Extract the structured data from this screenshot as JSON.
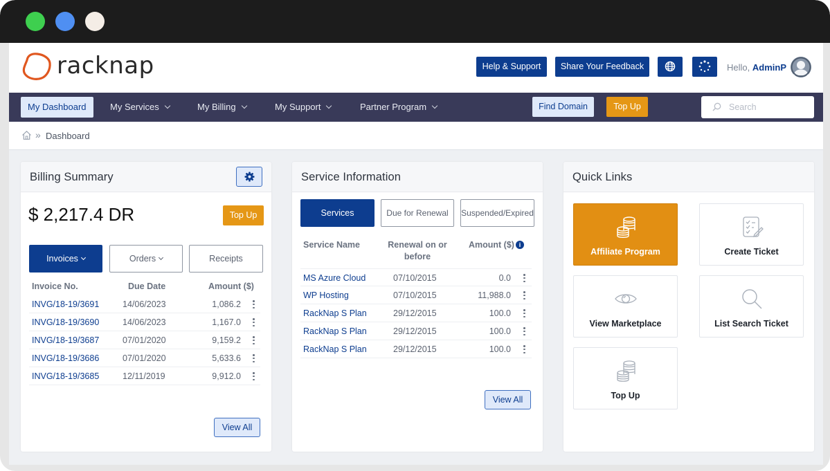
{
  "header": {
    "logo_text": "racknap",
    "help_label": "Help & Support",
    "feedback_label": "Share Your Feedback",
    "greeting": "Hello,",
    "user": "AdminP"
  },
  "nav": {
    "items": [
      {
        "label": "My Dashboard"
      },
      {
        "label": "My Services"
      },
      {
        "label": "My Billing"
      },
      {
        "label": "My Support"
      },
      {
        "label": "Partner Program"
      }
    ],
    "find_domain": "Find Domain",
    "top_up": "Top Up",
    "search_placeholder": "Search"
  },
  "breadcrumb": {
    "sep": "»",
    "current": "Dashboard"
  },
  "billing": {
    "title": "Billing Summary",
    "balance": "$ 2,217.4 DR",
    "top_up": "Top Up",
    "tabs": [
      "Invoices",
      "Orders",
      "Receipts"
    ],
    "headers": [
      "Invoice No.",
      "Due Date",
      "Amount ($)"
    ],
    "rows": [
      {
        "no": "INVG/18-19/3691",
        "date": "14/06/2023",
        "amount": "1,086.2"
      },
      {
        "no": "INVG/18-19/3690",
        "date": "14/06/2023",
        "amount": "1,167.0"
      },
      {
        "no": "INVG/18-19/3687",
        "date": "07/01/2020",
        "amount": "9,159.2"
      },
      {
        "no": "INVG/18-19/3686",
        "date": "07/01/2020",
        "amount": "5,633.6"
      },
      {
        "no": "INVG/18-19/3685",
        "date": "12/11/2019",
        "amount": "9,912.0"
      }
    ],
    "view_all": "View All"
  },
  "service": {
    "title": "Service Information",
    "tabs": [
      "Services",
      "Due for Renewal",
      "Suspended/Expired"
    ],
    "headers": [
      "Service Name",
      "Renewal on or",
      "before",
      "Amount ($)"
    ],
    "info_glyph": "i",
    "rows": [
      {
        "name": "MS Azure Cloud",
        "date": "07/10/2015",
        "amount": "0.0"
      },
      {
        "name": "WP Hosting",
        "date": "07/10/2015",
        "amount": "11,988.0"
      },
      {
        "name": "RackNap S Plan",
        "date": "29/12/2015",
        "amount": "100.0"
      },
      {
        "name": "RackNap S Plan",
        "date": "29/12/2015",
        "amount": "100.0"
      },
      {
        "name": "RackNap S Plan",
        "date": "29/12/2015",
        "amount": "100.0"
      }
    ],
    "view_all": "View All"
  },
  "quick": {
    "title": "Quick Links",
    "links": [
      {
        "label": "Affiliate Program",
        "icon": "coins-icon"
      },
      {
        "label": "Create Ticket",
        "icon": "checklist-icon"
      },
      {
        "label": "View Marketplace",
        "icon": "eye-icon"
      },
      {
        "label": "List Search Ticket",
        "icon": "magnifier-icon"
      },
      {
        "label": "Top Up",
        "icon": "coins-icon"
      }
    ]
  },
  "colors": {
    "primary": "#0d3d8f",
    "nav_bg": "#393a59",
    "accent": "#e59716",
    "logo": "#e0571f"
  }
}
